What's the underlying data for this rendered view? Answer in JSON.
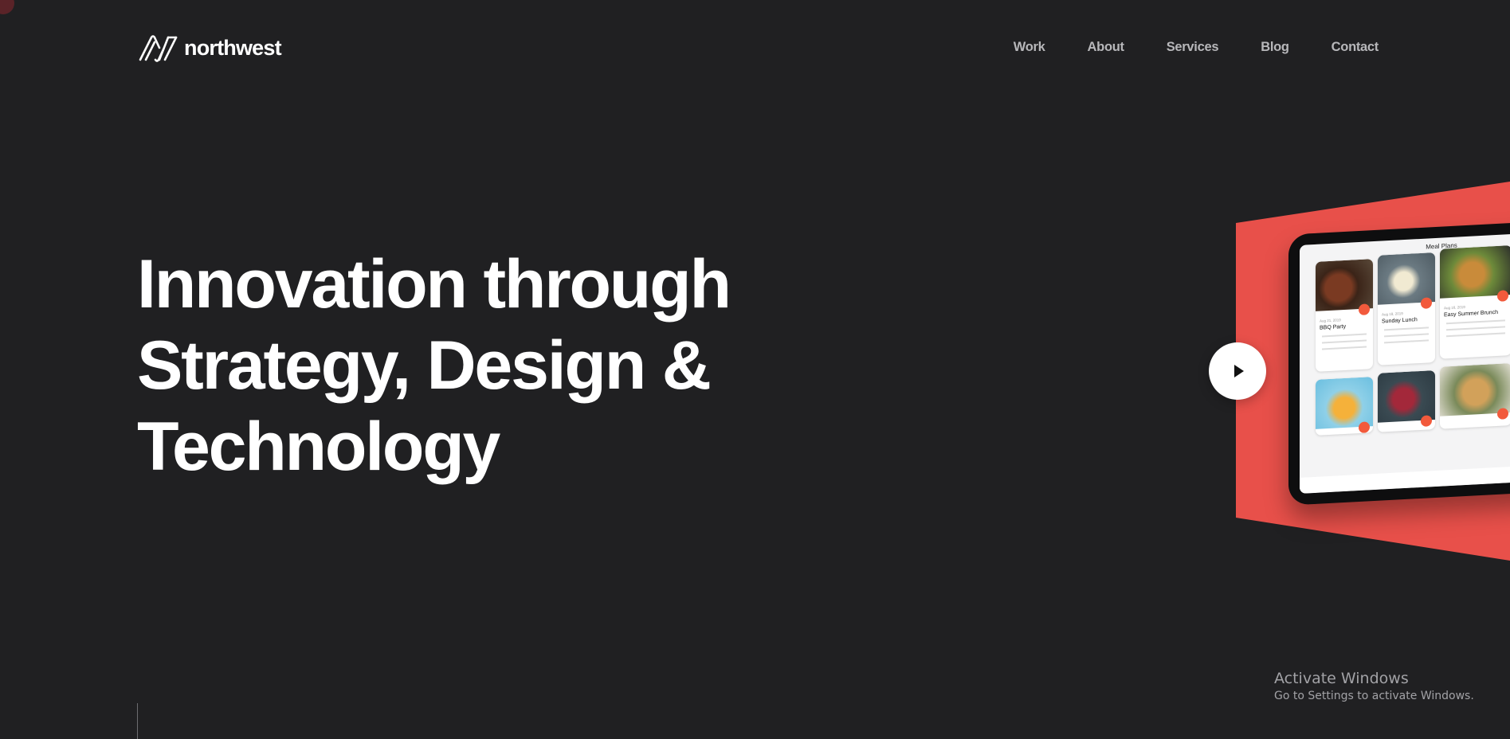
{
  "brand": {
    "name": "northwest",
    "logo_icon": "nw-monogram-icon"
  },
  "nav": {
    "items": [
      {
        "label": "Work"
      },
      {
        "label": "About"
      },
      {
        "label": "Services"
      },
      {
        "label": "Blog"
      },
      {
        "label": "Contact"
      }
    ]
  },
  "hero": {
    "lines": [
      "Innovation through",
      "Strategy, Design &",
      "Technology"
    ]
  },
  "showcase": {
    "accent_color": "#e8504a",
    "screen_title": "Meal Plans",
    "cards": [
      {
        "name": "BBQ Party",
        "date": "Aug 21, 2019"
      },
      {
        "name": "Sunday Lunch",
        "date": "Aug 18, 2019"
      },
      {
        "name": "Easy Summer Brunch",
        "date": "Aug 16, 2019"
      }
    ],
    "play_icon": "play-icon"
  },
  "watermark": {
    "title": "Activate Windows",
    "subtitle": "Go to Settings to activate Windows."
  },
  "colors": {
    "background": "#202022",
    "nav_text": "#b7b7ba",
    "heading": "#ffffff"
  }
}
